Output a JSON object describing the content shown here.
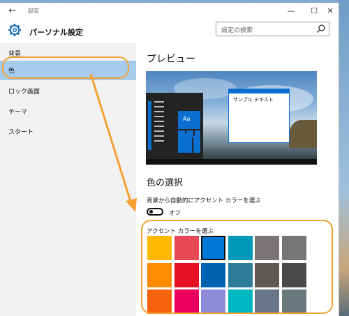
{
  "window": {
    "title": "設定"
  },
  "titlebar": {
    "back_glyph": "←",
    "minimize_glyph": "—",
    "maximize_glyph": "☐",
    "close_glyph": "✕"
  },
  "header": {
    "title": "パーソナル設定"
  },
  "search": {
    "placeholder": "設定の検索"
  },
  "sidebar": {
    "items": [
      {
        "label": "背景",
        "selected": false
      },
      {
        "label": "色",
        "selected": true
      },
      {
        "label": "ロック画面",
        "selected": false
      },
      {
        "label": "テーマ",
        "selected": false
      },
      {
        "label": "スタート",
        "selected": false
      }
    ]
  },
  "preview": {
    "heading": "プレビュー",
    "tile_label": "Aa",
    "sample_window_text": "サンプル テキスト"
  },
  "colors": {
    "heading": "色の選択",
    "auto_accent_label": "背景から自動的にアクセント カラーを選ぶ",
    "toggle_state": "オフ",
    "accent_label": "アクセント カラーを選ぶ",
    "selected_index": 2,
    "swatches": [
      "#ffb900",
      "#e74856",
      "#0078d7",
      "#0099bc",
      "#7a7574",
      "#767676",
      "#ff8c00",
      "#e81123",
      "#0063b1",
      "#2d7d9a",
      "#5d5a58",
      "#4c4a48",
      "#f7630c",
      "#ea005e",
      "#8e8cd8",
      "#00b7c3",
      "#68768a",
      "#69797e"
    ]
  },
  "theme": {
    "accent": "#0a6fd1",
    "selection": "#a6cbec",
    "annotation": "#f5a033"
  }
}
